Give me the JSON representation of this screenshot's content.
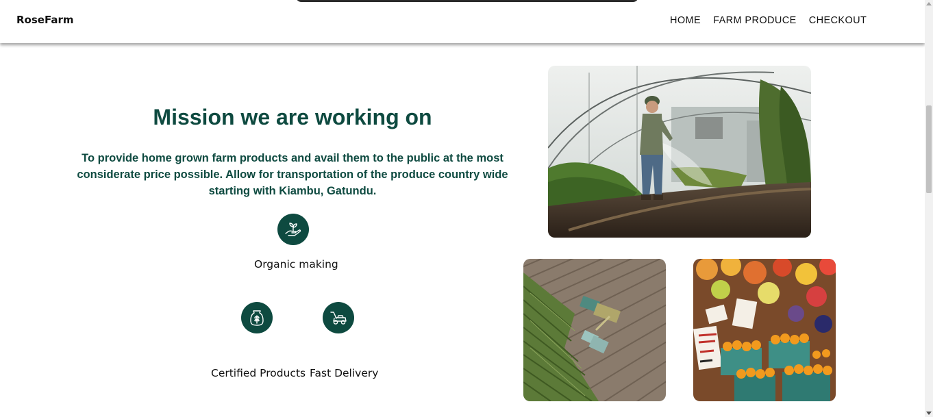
{
  "navbar": {
    "brand": "RoseFarm",
    "links": [
      "HOME",
      "FARM PRODUCE",
      "CHECKOUT"
    ]
  },
  "mission": {
    "title": "Mission we are working on",
    "body": "To provide home grown farm products and avail them to the public at the most considerate price possible. Allow for transportation of the produce country wide starting with Kiambu, Gatundu."
  },
  "features": [
    {
      "label": "Organic making",
      "icon": "plant-in-hand-icon"
    },
    {
      "label": "Certified Products",
      "icon": "grain-sack-icon"
    },
    {
      "label": "Fast Delivery",
      "icon": "lawn-mower-icon"
    }
  ],
  "images": [
    {
      "description": "farmer-watering-greenhouse-photo"
    },
    {
      "description": "aerial-tractor-harvest-photo"
    },
    {
      "description": "market-produce-stall-photo"
    }
  ],
  "colors": {
    "accent": "#0e4a40",
    "text": "#111111",
    "background": "#ffffff"
  }
}
